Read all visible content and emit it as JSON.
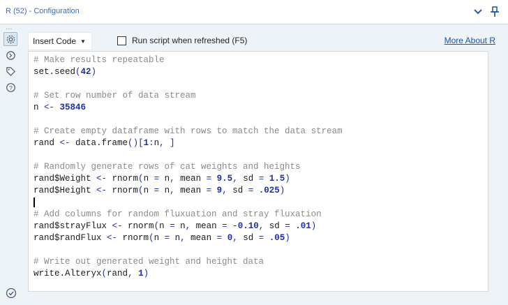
{
  "window": {
    "title": "R (52) - Configuration"
  },
  "header": {
    "collapse_icon": "chevron-down-icon",
    "pin_icon": "pin-icon"
  },
  "rail": {
    "items": [
      {
        "icon": "gear-icon",
        "active": true
      },
      {
        "icon": "connection-icon"
      },
      {
        "icon": "tag-icon"
      },
      {
        "icon": "help-icon"
      }
    ],
    "status_icon": "check-circle-icon"
  },
  "toolbar": {
    "insert_code_label": "Insert Code",
    "run_script_label": "Run script when refreshed (F5)",
    "run_script_checked": false,
    "more_about_label": "More About R"
  },
  "editor": {
    "lines": [
      "# Make results repeatable",
      "set.seed(42)",
      "",
      "# Set row number of data stream",
      "n <- 35846",
      "",
      "# Create empty dataframe with rows to match the data stream",
      "rand <- data.frame()[1:n, ]",
      "",
      "# Randomly generate rows of cat weights and heights",
      "rand$Weight <- rnorm(n = n, mean = 9.5, sd = 1.5)",
      "rand$Height <- rnorm(n = n, mean = 9, sd = .025)",
      "",
      "# Add columns for random fluxuation and stray fluxation",
      "rand$strayFlux <- rnorm(n = n, mean = -0.10, sd = .01)",
      "rand$randFlux <- rnorm(n = n, mean = 0, sd = .05)",
      "",
      "# Write out generated weight and height data",
      "write.Alteryx(rand, 1)"
    ]
  }
}
